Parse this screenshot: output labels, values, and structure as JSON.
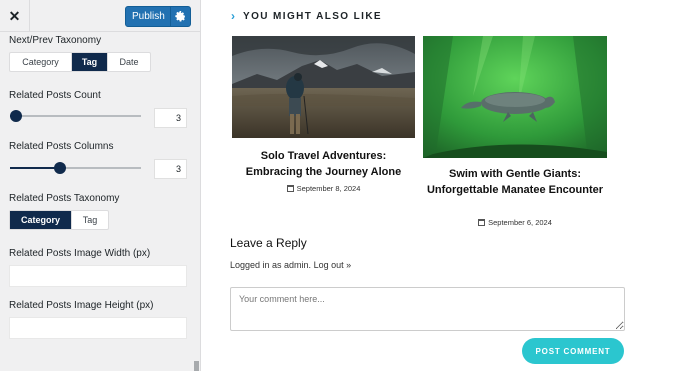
{
  "sidebar": {
    "close_glyph": "✕",
    "publish_label": "Publish",
    "next_prev_taxonomy": {
      "label": "Next/Prev Taxonomy",
      "options": [
        "Category",
        "Tag",
        "Date"
      ],
      "selected": "Tag"
    },
    "related_posts_count": {
      "label": "Related Posts Count",
      "value": "3",
      "slider_fraction": 0.0
    },
    "related_posts_columns": {
      "label": "Related Posts Columns",
      "value": "3",
      "slider_fraction": 0.38
    },
    "related_posts_taxonomy": {
      "label": "Related Posts Taxonomy",
      "options": [
        "Category",
        "Tag"
      ],
      "selected": "Category"
    },
    "image_width": {
      "label": "Related Posts Image Width (px)",
      "value": ""
    },
    "image_height": {
      "label": "Related Posts Image Height (px)",
      "value": ""
    }
  },
  "preview": {
    "related_heading": "YOU MIGHT ALSO LIKE",
    "posts": [
      {
        "title": "Solo Travel Adventures: Embracing the Journey Alone",
        "date": "September 8, 2024",
        "image_icon": "hiker-mountain-image"
      },
      {
        "title": "Swim with Gentle Giants: Unforgettable Manatee Encounter",
        "date": "September 6, 2024",
        "image_icon": "manatee-underwater-image"
      }
    ],
    "reply": {
      "title": "Leave a Reply",
      "logged_in_prefix": "Logged in as admin.",
      "logout_link": "Log out »",
      "comment_placeholder": "Your comment here...",
      "submit_label": "POST COMMENT"
    }
  },
  "colors": {
    "accent_navy": "#102a4c",
    "publish_blue": "#2271b1",
    "cta_teal": "#2bc6cf",
    "chevron_blue": "#2a9fd6"
  }
}
